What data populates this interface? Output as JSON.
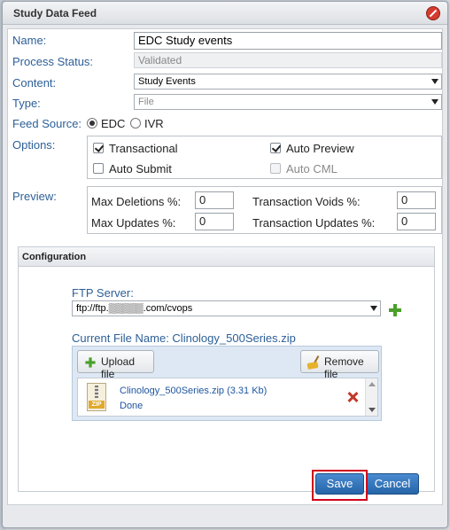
{
  "dialog": {
    "title": "Study Data Feed"
  },
  "form": {
    "name_label": "Name:",
    "name_value": "EDC Study events",
    "status_label": "Process Status:",
    "status_value": "Validated",
    "content_label": "Content:",
    "content_value": "Study Events",
    "type_label": "Type:",
    "type_value": "File",
    "feed_source_label": "Feed Source:",
    "feed_source_options": [
      "EDC",
      "IVR"
    ],
    "feed_source_selected": "EDC",
    "options_label": "Options:",
    "options": {
      "transactional": {
        "label": "Transactional",
        "checked": true
      },
      "auto_preview": {
        "label": "Auto Preview",
        "checked": true
      },
      "auto_submit": {
        "label": "Auto Submit",
        "checked": false
      },
      "auto_cml": {
        "label": "Auto CML",
        "checked": false,
        "disabled": true
      }
    },
    "preview_label": "Preview:",
    "preview": {
      "max_deletions_label": "Max Deletions %:",
      "max_deletions_value": "0",
      "transaction_voids_label": "Transaction Voids %:",
      "transaction_voids_value": "0",
      "max_updates_label": "Max Updates %:",
      "max_updates_value": "0",
      "transaction_updates_label": "Transaction Updates %:",
      "transaction_updates_value": "0"
    }
  },
  "configuration": {
    "header": "Configuration",
    "ftp_label": "FTP Server:",
    "ftp_value": "ftp://ftp.▒▒▒▒▒.com/cvops",
    "current_file_label": "Current File Name: Clinology_500Series.zip",
    "upload_label": "Upload file",
    "remove_label": "Remove file",
    "file": {
      "name": "Clinology_500Series.zip (3.31 Kb)",
      "status": "Done",
      "type_tag": "ZIP"
    }
  },
  "footer": {
    "save_label": "Save",
    "cancel_label": "Cancel"
  },
  "colors": {
    "label_blue": "#2c5f97",
    "button_blue": "#2565a8",
    "highlight_red": "#d0021b",
    "add_green": "#4aa02a"
  }
}
